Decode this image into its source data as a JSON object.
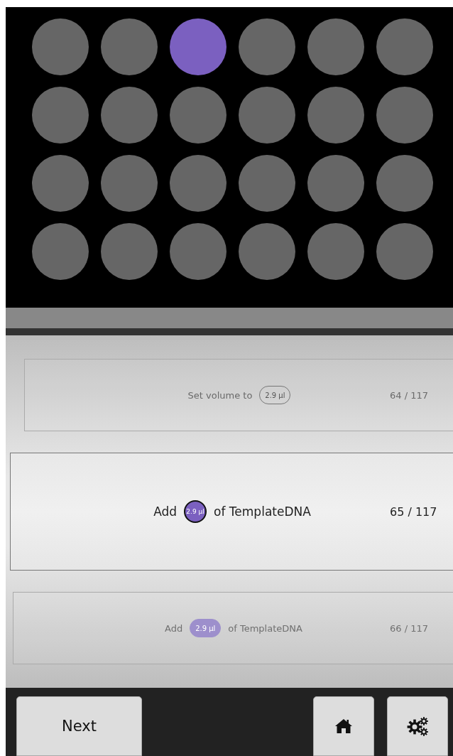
{
  "plate": {
    "rows": [
      [
        {
          "selected": false
        },
        {
          "selected": false
        },
        {
          "selected": true
        },
        {
          "selected": false
        },
        {
          "selected": false
        },
        {
          "selected": false
        }
      ],
      [
        {
          "selected": false
        },
        {
          "selected": false
        },
        {
          "selected": false
        },
        {
          "selected": false
        },
        {
          "selected": false
        },
        {
          "selected": false
        }
      ],
      [
        {
          "selected": false
        },
        {
          "selected": false
        },
        {
          "selected": false
        },
        {
          "selected": false
        },
        {
          "selected": false
        },
        {
          "selected": false
        }
      ],
      [
        {
          "selected": false
        },
        {
          "selected": false
        },
        {
          "selected": false
        },
        {
          "selected": false
        },
        {
          "selected": false
        },
        {
          "selected": false
        }
      ]
    ]
  },
  "steps": [
    {
      "kind": "previous",
      "prefix": "Set volume to",
      "volume": "2.9 µl",
      "volume_filled": false,
      "counter": "64 / 117"
    },
    {
      "kind": "current",
      "prefix": "Add",
      "volume": "2.9 µl",
      "volume_filled": true,
      "suffix": "of TemplateDNA",
      "counter": "65 / 117"
    },
    {
      "kind": "next",
      "prefix": "Add",
      "volume": "2.9 µl",
      "volume_filled": true,
      "suffix": "of TemplateDNA",
      "counter": "66 / 117"
    }
  ],
  "toolbar": {
    "next_label": "Next"
  }
}
